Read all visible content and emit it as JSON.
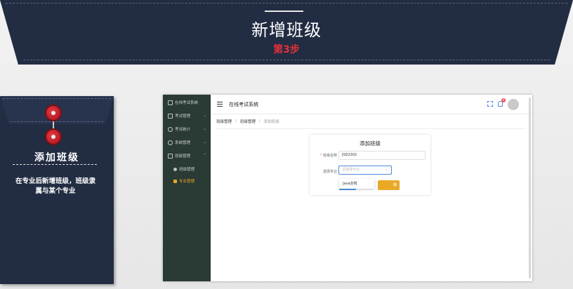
{
  "banner": {
    "title": "新增班级",
    "step": "第3步"
  },
  "envelope": {
    "title": "添加班级",
    "description": "在专业后新增班级，班级隶属与某个专业"
  },
  "app": {
    "title": "在线考试系统",
    "notification_count": "0",
    "sidebar": {
      "header": "在线考试系统",
      "items": [
        {
          "label": "考试管理"
        },
        {
          "label": "考试统计"
        },
        {
          "label": "系统管理"
        },
        {
          "label": "班级管理"
        }
      ],
      "subitems": [
        {
          "label": "班级管理"
        },
        {
          "label": "专业管理"
        }
      ]
    },
    "breadcrumb": {
      "item1": "班级管理",
      "item2": "班级管理",
      "current": "添加班级"
    },
    "form": {
      "title": "添加班级",
      "class_name_label": "班级名称",
      "class_name_value": "JSD2302",
      "major_label": "选择专业",
      "major_placeholder": "请选择专业",
      "dropdown_option": "Java全栈",
      "submit_label": "确"
    }
  },
  "colors": {
    "navy": "#222c42",
    "step_red": "#e8313a",
    "accent_orange": "#e9a826",
    "sidebar_bg": "#2a3a35",
    "link_blue": "#4a8ad9"
  }
}
